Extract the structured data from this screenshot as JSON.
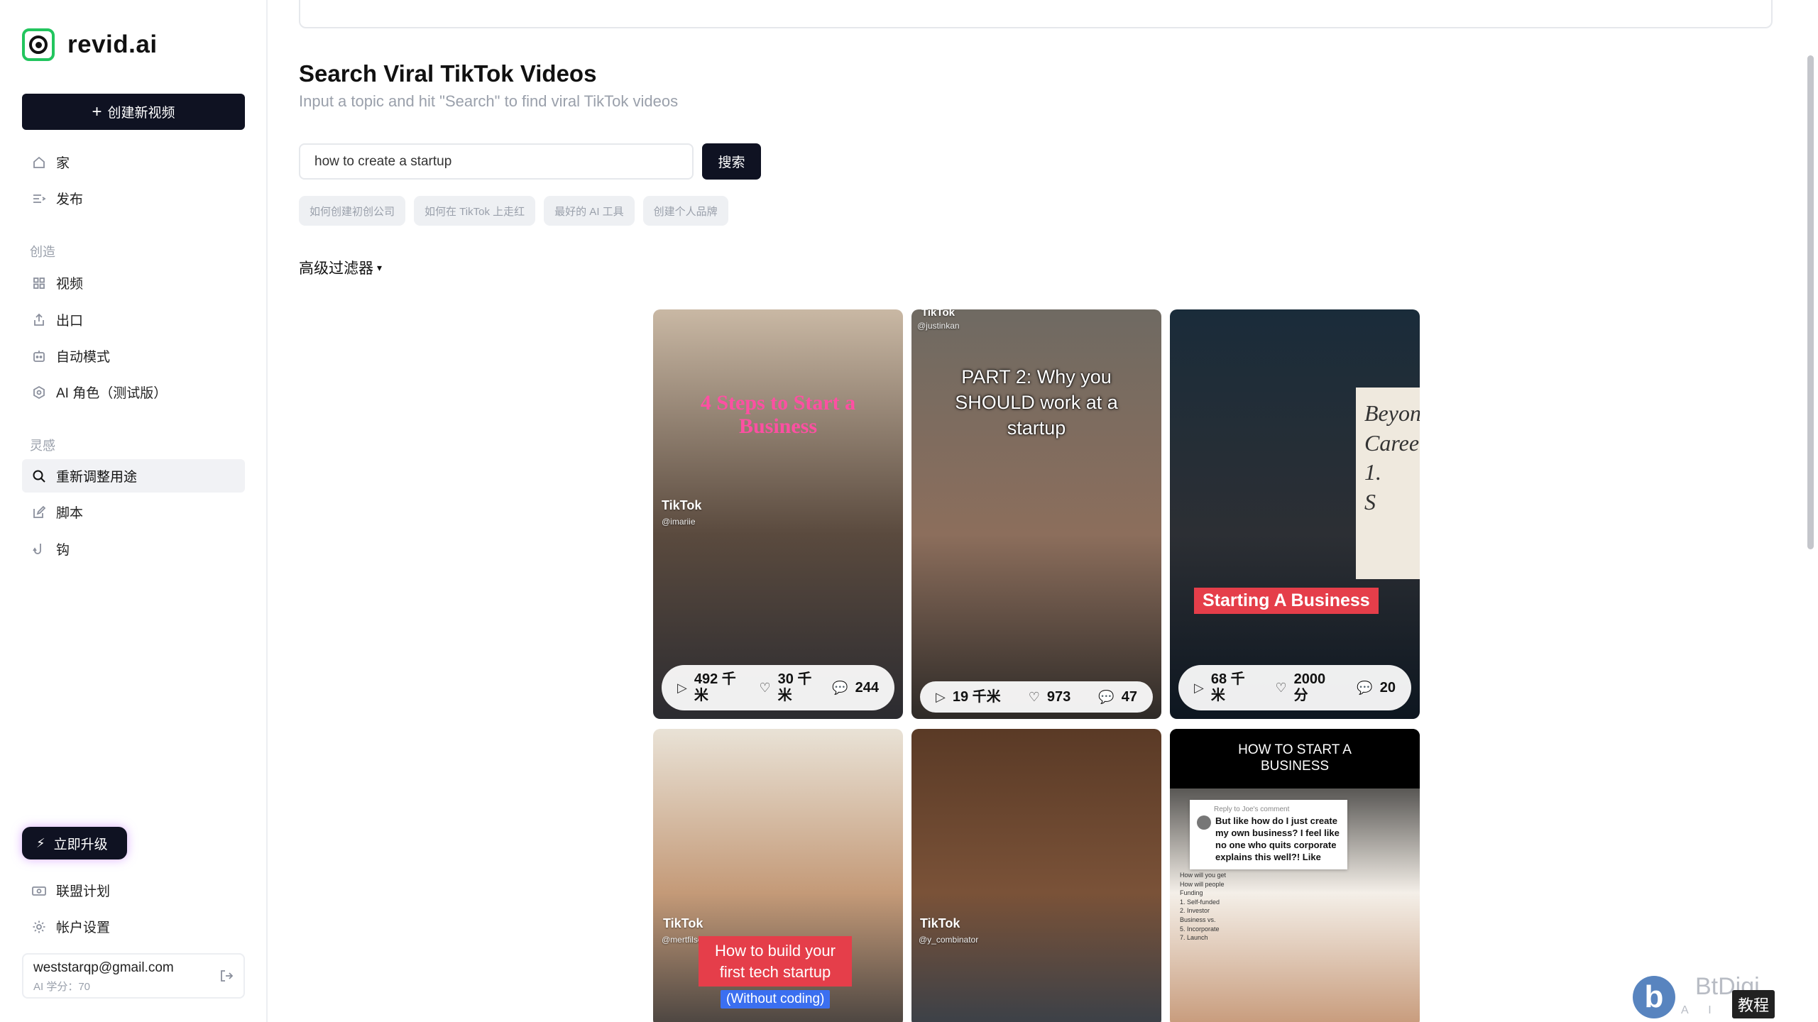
{
  "brand": {
    "name": "revid.ai"
  },
  "sidebar": {
    "create_label": "创建新视频",
    "main_items": [
      {
        "label": "家",
        "icon": "home-icon"
      },
      {
        "label": "发布",
        "icon": "publish-icon"
      }
    ],
    "create_section": "创造",
    "create_items": [
      {
        "label": "视频",
        "icon": "grid-icon"
      },
      {
        "label": "出口",
        "icon": "export-icon"
      },
      {
        "label": "自动模式",
        "icon": "robot-icon"
      },
      {
        "label": "AI 角色（测试版）",
        "icon": "hexagon-icon"
      }
    ],
    "inspiration_section": "灵感",
    "inspiration_items": [
      {
        "label": "重新调整用途",
        "icon": "search-icon",
        "active": true
      },
      {
        "label": "脚本",
        "icon": "edit-icon"
      },
      {
        "label": "钩",
        "icon": "hook-icon"
      }
    ],
    "upgrade_label": "立即升级",
    "bottom_items": [
      {
        "label": "联盟计划",
        "icon": "affiliate-icon"
      },
      {
        "label": "帐户设置",
        "icon": "gear-icon"
      }
    ],
    "account": {
      "email": "weststarqp@gmail.com",
      "credits": "AI 学分：70"
    }
  },
  "main": {
    "title": "Search Viral TikTok Videos",
    "subtitle": "Input a topic and hit \"Search\" to find viral TikTok videos",
    "search": {
      "value": "how to create a startup",
      "button_label": "搜索"
    },
    "chips": [
      "如何创建初创公司",
      "如何在 TikTok 上走红",
      "最好的 AI 工具",
      "创建个人品牌"
    ],
    "filter_label": "高级过滤器"
  },
  "videos": [
    {
      "caption": "4 Steps to Start a Business",
      "tag": "TikTok",
      "handle": "@imariie",
      "views": "492 千米",
      "likes": "30 千米",
      "comments": "244",
      "colors": {
        "top": "#c9b8a4",
        "mid": "#5a4a3e",
        "bottom": "#2b2b30",
        "caption": "#ff4fa3"
      }
    },
    {
      "caption": "PART 2: Why you SHOULD work at a startup",
      "tag": "TikTok",
      "handle": "@justinkan",
      "views": "19 千米",
      "likes": "973",
      "comments": "47",
      "colors": {
        "top": "#6f6a62",
        "mid": "#8c6e5c",
        "bottom": "#2e2a27",
        "caption": "#ffffff"
      }
    },
    {
      "caption": "Starting A Business",
      "board_text": "Beyon Career 1. S",
      "views": "68 千米",
      "likes": "2000 分",
      "comments": "20",
      "colors": {
        "top": "#1a2c3a",
        "mid": "#2c2f34",
        "bottom": "#0d1620",
        "caption": "#e53e4a"
      }
    },
    {
      "caption": "How to build your first tech startup",
      "subcaption": "(Without coding)",
      "tag": "TikTok",
      "handle": "@mertfilser",
      "colors": {
        "top": "#e9e2d6",
        "mid": "#c49a78",
        "bottom": "#4a4440",
        "caption": "#e53e4a"
      }
    },
    {
      "tag": "TikTok",
      "handle": "@y_combinator",
      "colors": {
        "top": "#5a3a26",
        "mid": "#7a5238",
        "bottom": "#3a4048",
        "caption": "#ffffff"
      }
    },
    {
      "header": "HOW TO START A BUSINESS",
      "reply_label": "Reply to Joe's comment",
      "comment": "But like how do I just create my own business? I feel like no one who quits corporate explains this well?! Like",
      "notes": [
        "How will you get",
        "How will people",
        "Funding",
        "1. Self-funded",
        "2. Investor",
        "Business vs.",
        "5. Incorporate",
        "7. Launch"
      ],
      "colors": {
        "top": "#000000",
        "mid": "#f4efe8",
        "bottom": "#c79a7a",
        "caption": "#ffffff"
      }
    }
  ],
  "watermark": {
    "text": "BtDigi",
    "sub": "A I G C",
    "badge": "教程"
  }
}
